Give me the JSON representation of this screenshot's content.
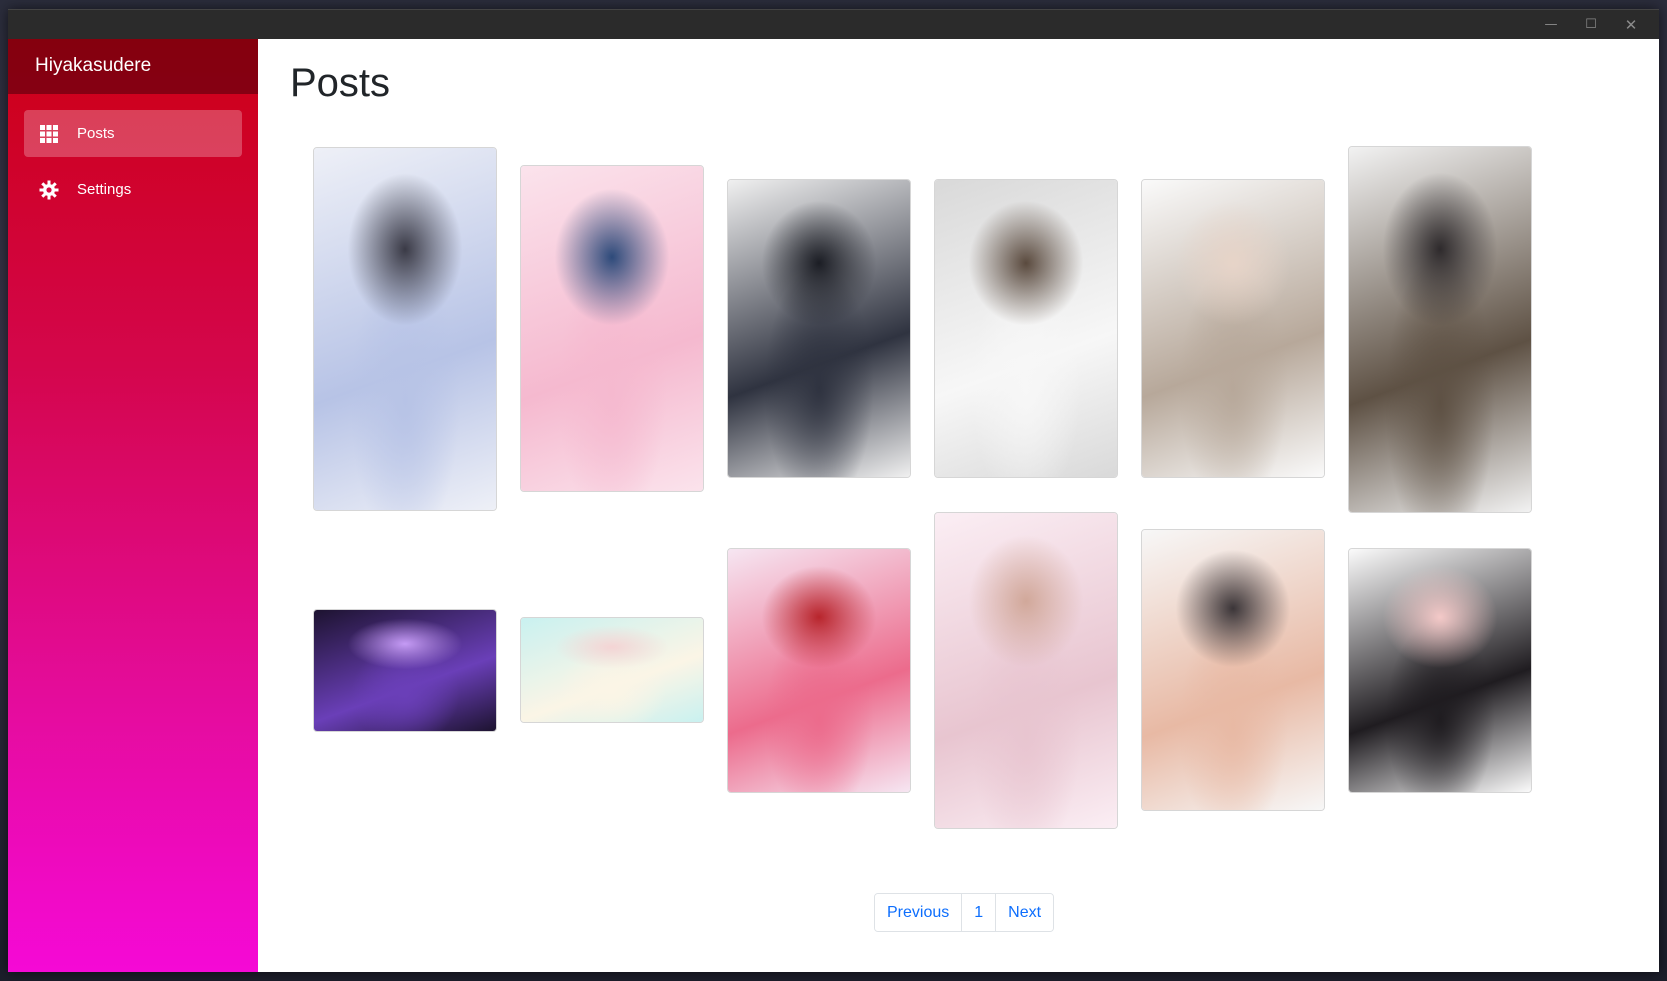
{
  "app": {
    "title": "Hiyakasudere"
  },
  "window_controls": {
    "minimize": "—",
    "maximize": "☐",
    "close": "✕"
  },
  "sidebar": {
    "items": [
      {
        "label": "Posts",
        "icon": "grid-icon",
        "active": true
      },
      {
        "label": "Settings",
        "icon": "gear-icon",
        "active": false
      }
    ]
  },
  "main": {
    "title": "Posts"
  },
  "posts": [
    {
      "name": "post-1",
      "palette": [
        "#eef0f7",
        "#b7c3e6",
        "#3a3a46"
      ]
    },
    {
      "name": "post-2",
      "palette": [
        "#fbe3ec",
        "#f5b9cf",
        "#2d4a7a"
      ]
    },
    {
      "name": "post-3",
      "palette": [
        "#f0f0f0",
        "#2f3340",
        "#1b1d24"
      ]
    },
    {
      "name": "post-4",
      "palette": [
        "#d9d9d9",
        "#f7f7f7",
        "#5a4a3e"
      ]
    },
    {
      "name": "post-5",
      "palette": [
        "#fafafa",
        "#b7a89a",
        "#e7d4c8"
      ]
    },
    {
      "name": "post-6",
      "palette": [
        "#f2f2f2",
        "#5e5144",
        "#2e2a2c"
      ]
    },
    {
      "name": "post-7",
      "palette": [
        "#1d1330",
        "#6a3fb8",
        "#c59bf5"
      ]
    },
    {
      "name": "post-8",
      "palette": [
        "#c9f1f0",
        "#fbf5e6",
        "#f4d4d4"
      ]
    },
    {
      "name": "post-9",
      "palette": [
        "#f6e6f2",
        "#ec6b8c",
        "#b8252c"
      ]
    },
    {
      "name": "post-10",
      "palette": [
        "#fbeef4",
        "#e8c5d0",
        "#d1a89a"
      ]
    },
    {
      "name": "post-11",
      "palette": [
        "#f7f7f7",
        "#e8b9a4",
        "#3b3538"
      ]
    },
    {
      "name": "post-12",
      "palette": [
        "#fbfbfb",
        "#1f1c20",
        "#f4c9c8"
      ]
    }
  ],
  "pagination": {
    "previous": "Previous",
    "current": "1",
    "next": "Next"
  }
}
